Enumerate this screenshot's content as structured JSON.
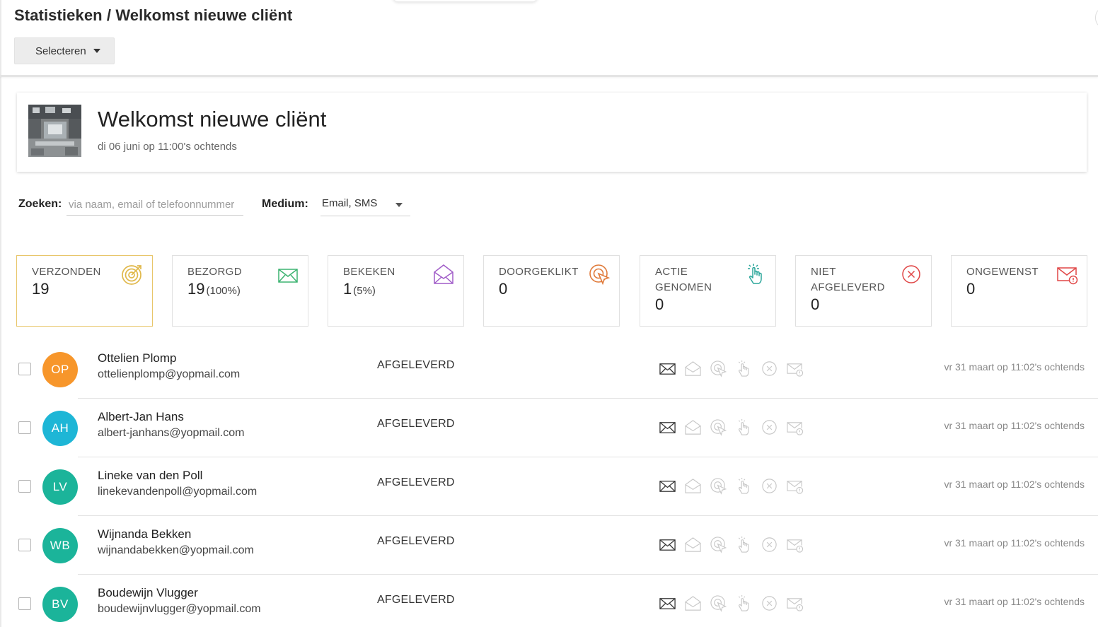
{
  "page": {
    "title": "Statistieken / Welkomst nieuwe cliënt"
  },
  "header": {
    "select_label": "Selecteren"
  },
  "campaign": {
    "title": "Welkomst nieuwe cliënt",
    "date": "di 06 juni op 11:00's ochtends"
  },
  "filters": {
    "search_label": "Zoeken:",
    "search_placeholder": "via naam, email of telefoonnummer",
    "search_value": "",
    "medium_label": "Medium:",
    "medium_value": "Email, SMS"
  },
  "stats": [
    {
      "label": "VERZONDEN",
      "value": "19",
      "percent": "",
      "icon": "target-icon",
      "color": "#e0b84a",
      "active": true
    },
    {
      "label": "BEZORGD",
      "value": "19",
      "percent": "(100%)",
      "icon": "envelope-icon",
      "color": "#3cb371",
      "active": false
    },
    {
      "label": "BEKEKEN",
      "value": "1",
      "percent": "(5%)",
      "icon": "open-envelope-icon",
      "color": "#a05cc8",
      "active": false
    },
    {
      "label": "DOORGEKLIKT",
      "value": "0",
      "percent": "",
      "icon": "click-icon",
      "color": "#e07a3a",
      "active": false
    },
    {
      "label": "ACTIE GENOMEN",
      "value": "0",
      "percent": "",
      "icon": "hand-pointer-icon",
      "color": "#2aa69a",
      "active": false
    },
    {
      "label": "NIET AFGELEVERD",
      "value": "0",
      "percent": "",
      "icon": "x-circle-icon",
      "color": "#e04646",
      "active": false
    },
    {
      "label": "ONGEWENST",
      "value": "0",
      "percent": "",
      "icon": "spam-envelope-icon",
      "color": "#e04646",
      "active": false
    }
  ],
  "recipients": [
    {
      "initials": "OP",
      "name": "Ottelien Plomp",
      "email": "ottelienplomp@yopmail.com",
      "status": "AFGELEVERD",
      "date": "vr 31 maart op 11:02's ochtends",
      "avatar_color": "#f7962b"
    },
    {
      "initials": "AH",
      "name": "Albert-Jan Hans",
      "email": "albert-janhans@yopmail.com",
      "status": "AFGELEVERD",
      "date": "vr 31 maart op 11:02's ochtends",
      "avatar_color": "#1eb6d6"
    },
    {
      "initials": "LV",
      "name": "Lineke van den Poll",
      "email": "linekevandenpoll@yopmail.com",
      "status": "AFGELEVERD",
      "date": "vr 31 maart op 11:02's ochtends",
      "avatar_color": "#1bb49a"
    },
    {
      "initials": "WB",
      "name": "Wijnanda Bekken",
      "email": "wijnandabekken@yopmail.com",
      "status": "AFGELEVERD",
      "date": "vr 31 maart op 11:02's ochtends",
      "avatar_color": "#1bb49a"
    },
    {
      "initials": "BV",
      "name": "Boudewijn Vlugger",
      "email": "boudewijnvlugger@yopmail.com",
      "status": "AFGELEVERD",
      "date": "vr 31 maart op 11:02's ochtends",
      "avatar_color": "#1bb49a"
    }
  ]
}
